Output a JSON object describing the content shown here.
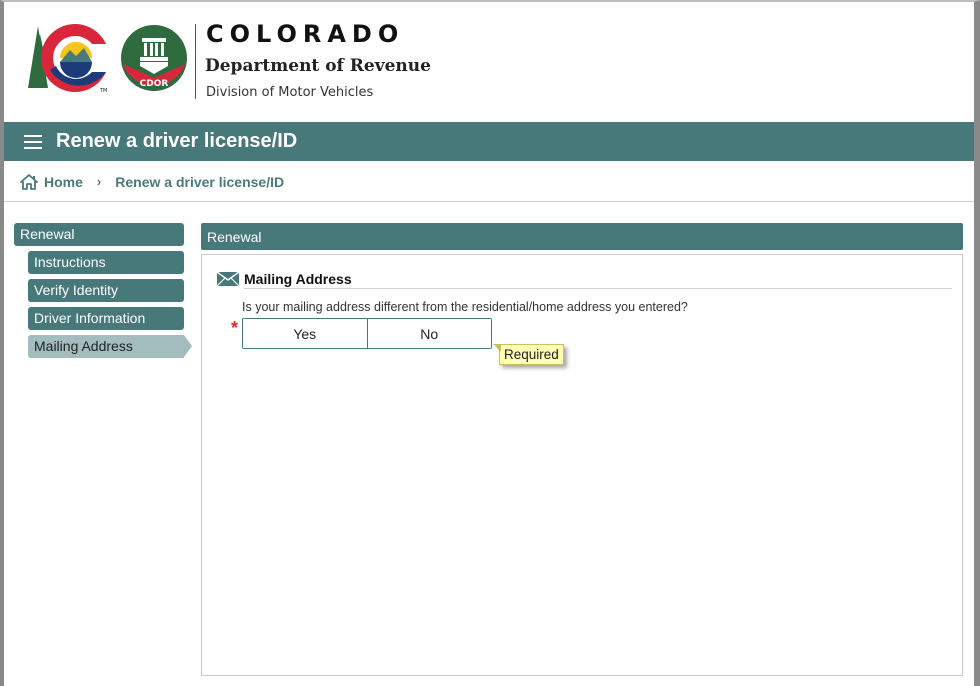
{
  "header": {
    "brand_title": "COLORADO",
    "department": "Department of Revenue",
    "division": "Division of Motor Vehicles",
    "cdor_badge": "CDOR",
    "tm_mark": "TM"
  },
  "titlebar": {
    "menu_icon": "hamburger-menu-icon",
    "title": "Renew a driver license/ID"
  },
  "breadcrumb": {
    "home_icon": "home-icon",
    "home_label": "Home",
    "separator": "›",
    "current": "Renew a driver license/ID"
  },
  "sidenav": {
    "parent": "Renewal",
    "items": [
      {
        "label": "Instructions",
        "active": false
      },
      {
        "label": "Verify Identity",
        "active": false
      },
      {
        "label": "Driver Information",
        "active": false
      },
      {
        "label": "Mailing Address",
        "active": true
      }
    ]
  },
  "panel": {
    "header": "Renewal",
    "section": {
      "icon": "envelope-icon",
      "title": "Mailing Address",
      "question": "Is your mailing address different from the residential/home address you entered?",
      "required_marker": "*",
      "options": [
        "Yes",
        "No"
      ],
      "selected": null,
      "tooltip": "Required"
    }
  },
  "colors": {
    "primary": "#47787a",
    "active_nav": "#a3bdbe",
    "required": "#e0242a",
    "tooltip_bg": "#ffffb4"
  }
}
